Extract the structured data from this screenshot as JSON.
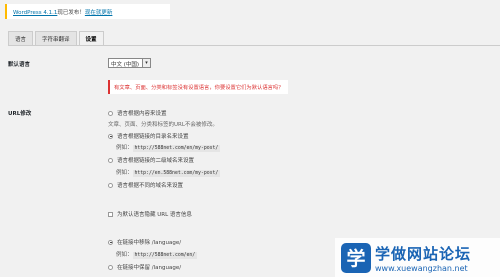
{
  "notice": {
    "version_link": "WordPress 4.1.1",
    "middle_text": "现已发布！",
    "update_link": "现在就更新"
  },
  "tabs": [
    {
      "label": "语言",
      "active": false
    },
    {
      "label": "字符串翻译",
      "active": false
    },
    {
      "label": "设置",
      "active": true
    }
  ],
  "settings": {
    "default_language_label": "默认语言",
    "default_language_value": "中文 (中国)",
    "error_message": "有文章、页面、分类和标签没有设置语言，你要设置它们为默认语言吗？",
    "url_modification_label": "URL修改",
    "url_options": [
      {
        "label": "语言根据内容来设置",
        "selected": false
      },
      {
        "label": "语言根据链接的目录名来设置",
        "selected": true
      },
      {
        "label": "语言根据链接的二级域名来设置",
        "selected": false
      },
      {
        "label": "语言根据不同的域名来设置",
        "selected": false
      }
    ],
    "content_desc": "文章、页面、分类和标签的URL不会被修改。",
    "example_prefix": "例如：",
    "example_dir": "http://588net.com/en/my-post/",
    "example_subdomain": "http://en.588net.com/my-post/",
    "hide_default_label": "为默认语言隐藏 URL 语言信息",
    "hide_default_checked": false,
    "slug_options": [
      {
        "label": "在链接中移除 /language/",
        "selected": true
      },
      {
        "label": "在链接中保留 /language/",
        "selected": false
      }
    ],
    "example_slug": "http://588net.com/en/"
  },
  "watermark": {
    "logo_char": "学",
    "title": "学做网站论坛",
    "url": "www.xuewangzhan.net"
  }
}
